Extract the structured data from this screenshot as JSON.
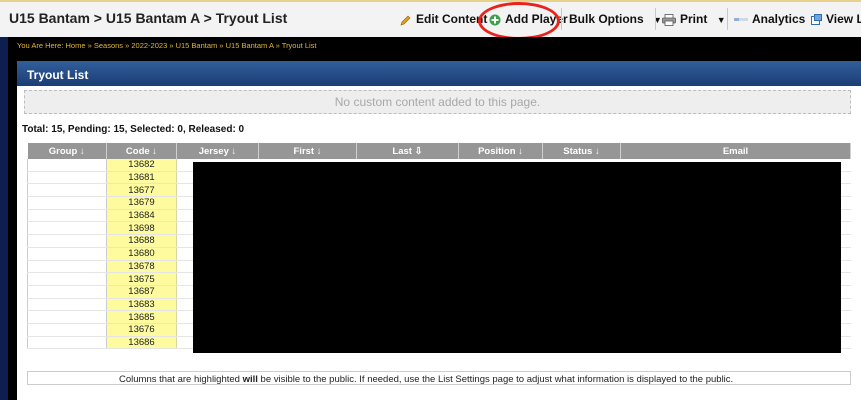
{
  "header": {
    "title": "U15 Bantam > U15 Bantam A > Tryout List",
    "toolbar": {
      "edit_content": "Edit Content",
      "add_player": "Add Player",
      "bulk_options": "Bulk Options",
      "print": "Print",
      "analytics": "Analytics",
      "view_live": "View Liv"
    }
  },
  "breadcrumb": "You Are Here: Home » Seasons » 2022-2023 » U15 Bantam » U15 Bantam A » Tryout List",
  "panel": {
    "title": "Tryout List",
    "custom_content_msg": "No custom content added to this page."
  },
  "totals": "Total: 15, Pending: 15, Selected: 0, Released: 0",
  "table": {
    "columns": [
      "Group ↓",
      "Code ↓",
      "Jersey ↓",
      "First ↓",
      "Last ⇩",
      "Position ↓",
      "Status ↓",
      "Email"
    ],
    "codes": [
      "13682",
      "13681",
      "13677",
      "13679",
      "13684",
      "13698",
      "13688",
      "13680",
      "13678",
      "13675",
      "13687",
      "13683",
      "13685",
      "13676",
      "13686"
    ]
  },
  "footnote": {
    "before": "Columns that are highlighted ",
    "bold": "will",
    "after": " be visible to the public. If needed, use the List Settings page to adjust what information is displayed to the public."
  },
  "colors": {
    "accent_circle": "#e8231b",
    "panel_header": "#1c3c74",
    "code_highlight": "#fdfb9e",
    "breadcrumb": "#e2b73b"
  },
  "icons": [
    "pencil-icon",
    "plus-circle-icon",
    "caret-down-icon",
    "printer-icon",
    "analytics-icon",
    "external-window-icon"
  ]
}
